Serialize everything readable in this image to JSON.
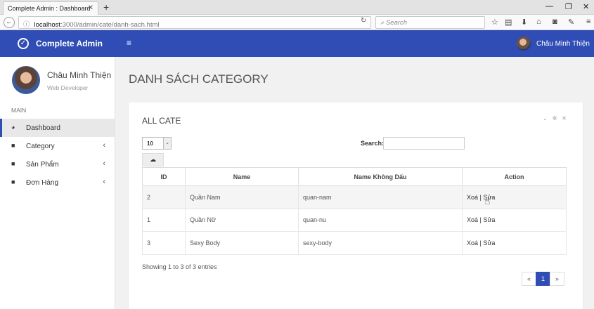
{
  "browser": {
    "tab_title": "Complete Admin : Dashboard",
    "tab_close": "✕",
    "new_tab": "+",
    "url_host": "localhost",
    "url_path": ":3000/admin/cate/danh-sach.html",
    "search_placeholder": "Search",
    "window_controls": [
      "—",
      "❐",
      "✕"
    ]
  },
  "header": {
    "brand": "Complete Admin",
    "menu_icon": "≡",
    "user_name": "Châu Minh Thiện"
  },
  "sidebar": {
    "profile_name": "Châu Minh Thiện",
    "profile_role": "Web Developer",
    "section_label": "MAIN",
    "items": [
      {
        "label": "Dashboard",
        "icon": "dashboard-icon",
        "glyph": "◕",
        "chevron": ""
      },
      {
        "label": "Category",
        "icon": "briefcase-icon",
        "glyph": "■",
        "chevron": "‹"
      },
      {
        "label": "Sản Phẩm",
        "icon": "briefcase-icon",
        "glyph": "■",
        "chevron": "‹"
      },
      {
        "label": "Đơn Hàng",
        "icon": "briefcase-icon",
        "glyph": "■",
        "chevron": "‹"
      }
    ]
  },
  "main": {
    "page_title": "DANH SÁCH CATEGORY",
    "panel_title": "ALL CATE",
    "panel_tools": "⌄✲✕",
    "length_value": "10",
    "search_label": "Search:",
    "search_value": "",
    "table": {
      "columns": [
        "ID",
        "Name",
        "Name Không Dấu",
        "Action"
      ],
      "rows": [
        {
          "id": "2",
          "name": "Quần Nam",
          "slug": "quan-nam",
          "action": "Xoá | Sửa"
        },
        {
          "id": "1",
          "name": "Quần Nữ",
          "slug": "quan-nu",
          "action": "Xoá | Sửa"
        },
        {
          "id": "3",
          "name": "Sexy Body",
          "slug": "sexy-body",
          "action": "Xoá | Sửa"
        }
      ]
    },
    "info": "Showing 1 to 3 of 3 entries",
    "pager": {
      "prev": "«",
      "current": "1",
      "next": "»"
    }
  }
}
